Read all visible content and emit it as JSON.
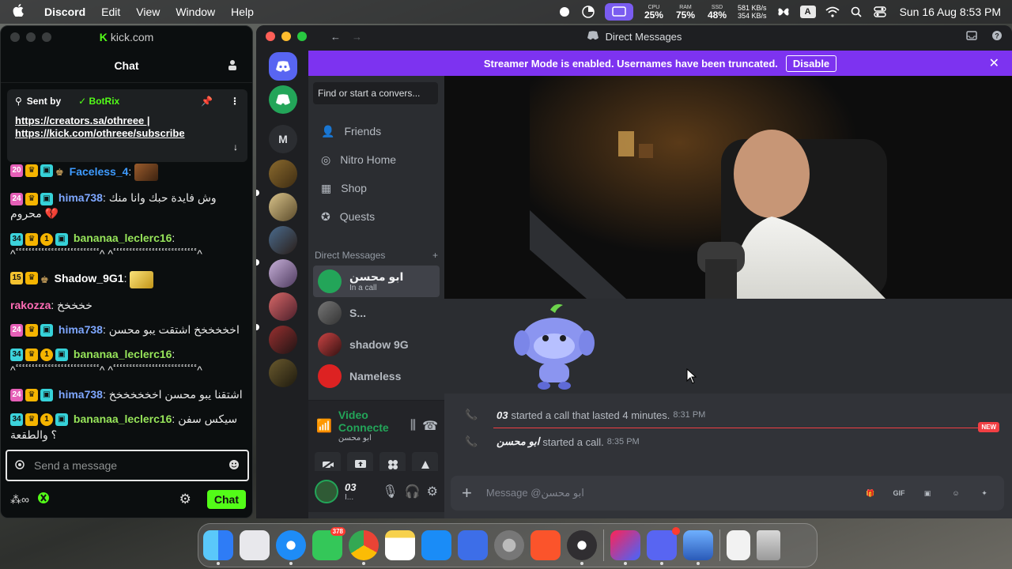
{
  "menubar": {
    "app_name": "Discord",
    "menus": [
      "Edit",
      "View",
      "Window",
      "Help"
    ],
    "cpu_label": "CPU",
    "cpu_value": "25%",
    "ram_label": "RAM",
    "ram_value": "75%",
    "ssd_label": "SSD",
    "ssd_value": "48%",
    "net_up": "581 KB/s",
    "net_down": "354 KB/s",
    "input_source": "A",
    "clock": "Sun 16 Aug  8:53 PM"
  },
  "kick": {
    "url": "kick.com",
    "logo_letter": "K",
    "chat_title": "Chat",
    "pinned": {
      "sent_by_label": "Sent by",
      "author": "BotRix",
      "link1": "https://creators.sa/othreee |",
      "link2": "https://kick.com/othreee/subscribe"
    },
    "messages": [
      {
        "sub": "20",
        "user": "Faceless_4",
        "color": "#3e9bff",
        "text": ":"
      },
      {
        "sub": "24",
        "user": "hima738",
        "color": "#7ea7ff",
        "text": ": وش فايدة حبك وانا منك محروم 💔"
      },
      {
        "sub": "34",
        "user": "bananaa_leclerc16",
        "color": "#97e55a",
        "text": ": ^ٴٴٴٴٴٴٴٴٴٴٴٴٴٴٴٴٴٴٴٴٴٴٴٴٴٴ^ ^ٴٴٴٴٴٴٴٴٴٴٴٴٴٴٴٴٴٴٴٴٴٴٴٴٴٴ^"
      },
      {
        "sub": "15",
        "user": "Shadow_9G1",
        "color": "#ffffff",
        "text": ":"
      },
      {
        "sub": "",
        "user": "rakozza",
        "color": "#ff6cb5",
        "text": ": خخخخخ"
      },
      {
        "sub": "24",
        "user": "hima738",
        "color": "#7ea7ff",
        "text": ": اخخخخخخ اشتقت يبو محسن"
      },
      {
        "sub": "34",
        "user": "bananaa_leclerc16",
        "color": "#97e55a",
        "text": ": ^ٴٴٴٴٴٴٴٴٴٴٴٴٴٴٴٴٴٴٴٴٴٴٴٴٴٴ^ ^ٴٴٴٴٴٴٴٴٴٴٴٴٴٴٴٴٴٴٴٴٴٴٴٴٴٴ^"
      },
      {
        "sub": "24",
        "user": "hima738",
        "color": "#7ea7ff",
        "text": ": اشتقنا يبو محسن اخخخخخخخ"
      },
      {
        "sub": "34",
        "user": "bananaa_leclerc16",
        "color": "#97e55a",
        "text": ": سيكس سفن ؟ والطقعة"
      }
    ],
    "input_placeholder": "Send a message",
    "chat_button": "Chat"
  },
  "discord": {
    "window_title": "Direct Messages",
    "banner_text": "Streamer Mode is enabled. Usernames have been truncated.",
    "banner_button": "Disable",
    "guild_letter": "M",
    "search_placeholder": "Find or start a convers...",
    "nav": [
      "Friends",
      "Nitro Home",
      "Shop",
      "Quests"
    ],
    "dm_header": "Direct Messages",
    "dms": [
      {
        "name": "ابو محسن",
        "status": "In a call"
      },
      {
        "name": "S...",
        "status": ""
      },
      {
        "name": "shadow 9G",
        "status": ""
      },
      {
        "name": "Nameless",
        "status": ""
      }
    ],
    "voice": {
      "title": "Video Connecte",
      "channel": "ابو محسن"
    },
    "user": {
      "name": "03",
      "status": "I..."
    },
    "messages": [
      {
        "who": "03",
        "text": "started a call that lasted 4 minutes.",
        "time": "8:31 PM"
      },
      {
        "who": "ابو محسن",
        "text": "started a call.",
        "time": "8:35 PM"
      }
    ],
    "new_label": "NEW",
    "composer_placeholder": "Message @ابو محسن",
    "gif_label": "GIF"
  },
  "dock": {
    "messages_badge": "378",
    "apps": [
      "finder",
      "launchpad",
      "safari",
      "messages",
      "chrome",
      "notes",
      "app-store",
      "notion",
      "system-settings",
      "brave",
      "obs",
      "copilot",
      "discord",
      "mirror",
      "files",
      "trash"
    ]
  },
  "colors": {
    "discord_blurple": "#5865f2",
    "streamer_purple": "#7d33f0",
    "kick_green": "#53fc18",
    "online_green": "#23a559"
  }
}
